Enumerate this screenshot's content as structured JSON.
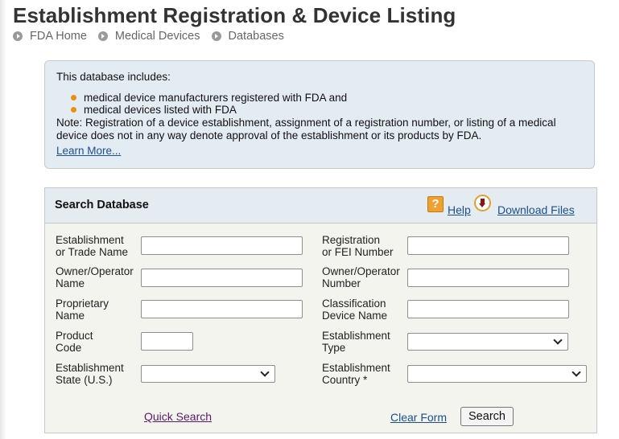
{
  "page": {
    "title": "Establishment Registration & Device Listing"
  },
  "breadcrumb": [
    {
      "label": "FDA Home"
    },
    {
      "label": "Medical Devices"
    },
    {
      "label": "Databases"
    }
  ],
  "info": {
    "intro": "This database includes:",
    "items": [
      "medical device manufacturers registered with FDA and",
      "medical devices listed with FDA"
    ],
    "note": "Note: Registration of a device establishment, assignment of a registration number, or listing of a medical device does not in any way denote approval of the establishment or its products by FDA.",
    "learn_more": "Learn More..."
  },
  "search": {
    "title": "Search Database",
    "help_label": "Help",
    "download_label": "Download Files",
    "fields": {
      "establishment_name": {
        "label_line1": "Establishment",
        "label_line2": "or Trade Name",
        "value": ""
      },
      "registration_number": {
        "label_line1": "Registration",
        "label_line2": "or FEI Number",
        "value": ""
      },
      "owner_name": {
        "label_line1": "Owner/Operator",
        "label_line2": "Name",
        "value": ""
      },
      "owner_number": {
        "label_line1": "Owner/Operator",
        "label_line2": "Number",
        "value": ""
      },
      "proprietary_name": {
        "label_line1": "Proprietary",
        "label_line2": "Name",
        "value": ""
      },
      "classification_name": {
        "label_line1": "Classification",
        "label_line2": "Device Name",
        "value": ""
      },
      "product_code": {
        "label_line1": "Product",
        "label_line2": "Code",
        "value": ""
      },
      "establishment_type": {
        "label_line1": "Establishment",
        "label_line2": "Type",
        "selected": ""
      },
      "establishment_state": {
        "label_line1": "Establishment",
        "label_line2": "State (U.S.)",
        "selected": ""
      },
      "establishment_country": {
        "label_line1": "Establishment",
        "label_line2": "Country *",
        "selected": ""
      }
    },
    "quick_search_label": "Quick Search",
    "clear_form_label": "Clear Form",
    "search_button_label": "Search"
  }
}
